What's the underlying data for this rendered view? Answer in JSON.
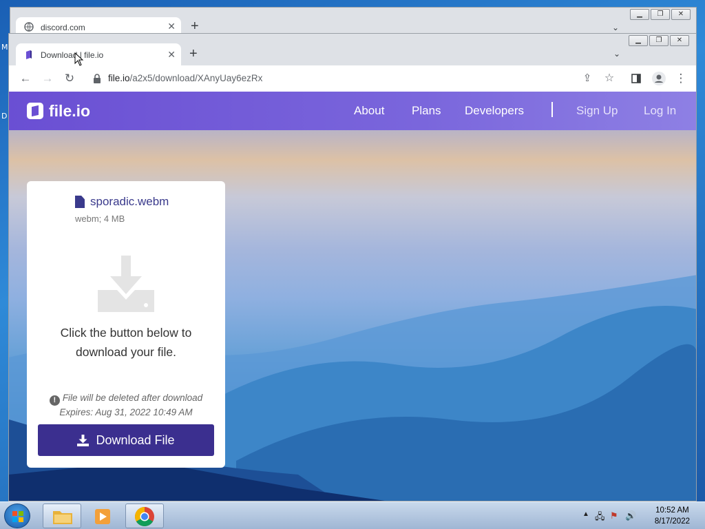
{
  "desktop": {
    "glyph_1": "M",
    "glyph_2": "D"
  },
  "back_window": {
    "tab_title": "discord.com"
  },
  "window": {
    "tab_title": "Download | file.io",
    "url_host": "file.io",
    "url_path": "/a2x5/download/XAnyUay6ezRx"
  },
  "site": {
    "logo": "file.io",
    "nav": [
      "About",
      "Plans",
      "Developers",
      "Sign Up",
      "Log In"
    ]
  },
  "card": {
    "file_name": "sporadic.webm",
    "file_meta": "webm; 4 MB",
    "message": "Click the button below to download your file.",
    "warning": "File will be deleted after download",
    "expires": "Expires: Aug 31, 2022 10:49 AM",
    "button_label": "Download File"
  },
  "taskbar": {
    "time": "10:52 AM",
    "date": "8/17/2022"
  },
  "colors": {
    "nav_purple": "#6a4fd3",
    "button_purple": "#3b2f8f",
    "file_name_color": "#3a3a8c"
  }
}
